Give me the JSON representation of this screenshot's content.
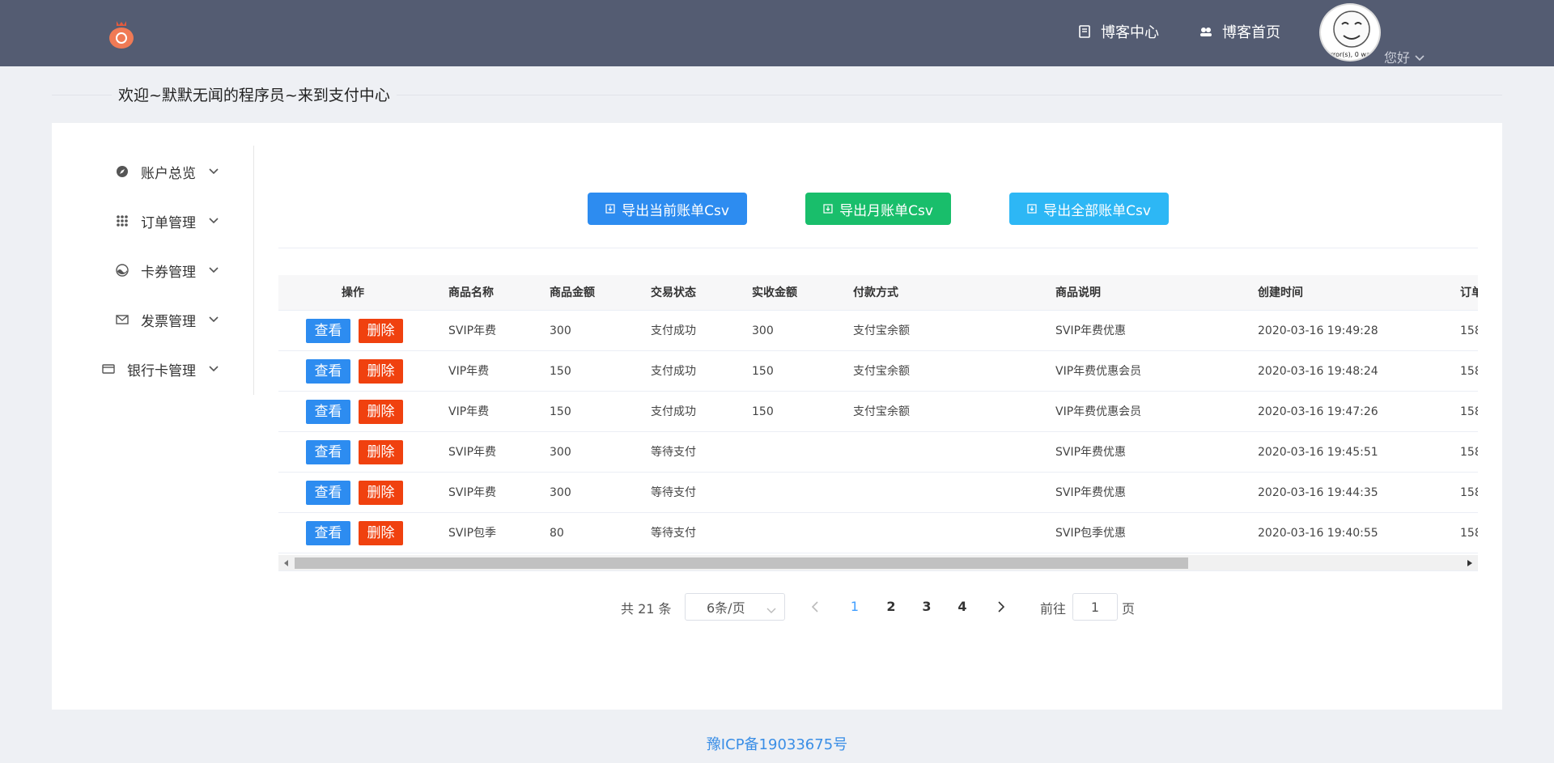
{
  "header": {
    "nav": [
      {
        "label": "博客中心",
        "icon": "book-icon"
      },
      {
        "label": "博客首页",
        "icon": "users-icon"
      }
    ],
    "avatar_text": "error(s), 0 warn",
    "greeting": "您好"
  },
  "welcome": "欢迎~默默无闻的程序员~来到支付中心",
  "sidebar": {
    "items": [
      {
        "label": "账户总览",
        "icon": "compass-icon"
      },
      {
        "label": "订单管理",
        "icon": "grid-icon"
      },
      {
        "label": "卡券管理",
        "icon": "coupon-icon"
      },
      {
        "label": "发票管理",
        "icon": "mail-icon"
      },
      {
        "label": "银行卡管理",
        "icon": "card-icon"
      }
    ]
  },
  "exports": [
    {
      "label": "导出当前账单Csv",
      "color": "#2d8cf0"
    },
    {
      "label": "导出月账单Csv",
      "color": "#19be6b"
    },
    {
      "label": "导出全部账单Csv",
      "color": "#2db7f5"
    }
  ],
  "table": {
    "columns": [
      "操作",
      "商品名称",
      "商品金额",
      "交易状态",
      "实收金额",
      "付款方式",
      "商品说明",
      "创建时间",
      "订单"
    ],
    "view_label": "查看",
    "delete_label": "删除",
    "rows": [
      {
        "name": "SVIP年费",
        "amount": "300",
        "status": "支付成功",
        "received": "300",
        "method": "支付宝余额",
        "desc": "SVIP年费优惠",
        "time": "2020-03-16 19:49:28",
        "order": "158"
      },
      {
        "name": "VIP年费",
        "amount": "150",
        "status": "支付成功",
        "received": "150",
        "method": "支付宝余额",
        "desc": "VIP年费优惠会员",
        "time": "2020-03-16 19:48:24",
        "order": "158"
      },
      {
        "name": "VIP年费",
        "amount": "150",
        "status": "支付成功",
        "received": "150",
        "method": "支付宝余额",
        "desc": "VIP年费优惠会员",
        "time": "2020-03-16 19:47:26",
        "order": "158"
      },
      {
        "name": "SVIP年费",
        "amount": "300",
        "status": "等待支付",
        "received": "",
        "method": "",
        "desc": "SVIP年费优惠",
        "time": "2020-03-16 19:45:51",
        "order": "158"
      },
      {
        "name": "SVIP年费",
        "amount": "300",
        "status": "等待支付",
        "received": "",
        "method": "",
        "desc": "SVIP年费优惠",
        "time": "2020-03-16 19:44:35",
        "order": "158"
      },
      {
        "name": "SVIP包季",
        "amount": "80",
        "status": "等待支付",
        "received": "",
        "method": "",
        "desc": "SVIP包季优惠",
        "time": "2020-03-16 19:40:55",
        "order": "158"
      }
    ]
  },
  "pagination": {
    "total_text": "共 21 条",
    "page_size": "6条/页",
    "pages": [
      "1",
      "2",
      "3",
      "4"
    ],
    "current": "1",
    "goto_prefix": "前往",
    "goto_value": "1",
    "goto_suffix": "页"
  },
  "footer": "豫ICP备19033675号"
}
